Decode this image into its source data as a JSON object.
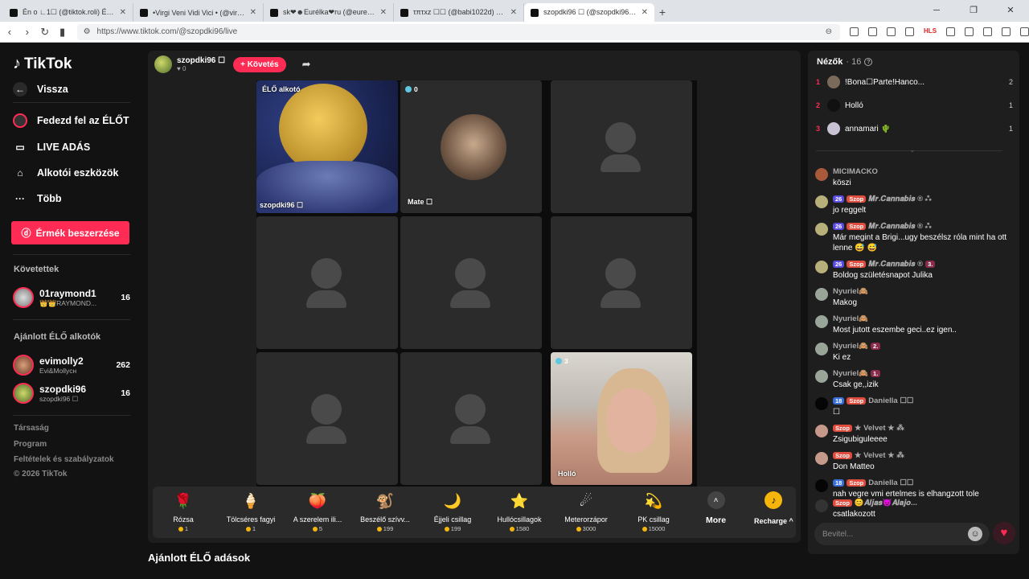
{
  "browser": {
    "tabs": [
      {
        "label": "Én o ∟1☐ (@tiktok.roli) ÉLŐ adá",
        "active": false
      },
      {
        "label": "•Virgi Veni Vidi Vici • (@virgivenivid",
        "active": false
      },
      {
        "label": "sk❤☻Eurélka❤ru (@eurekaeurel",
        "active": false
      },
      {
        "label": "τπτxz ☐☐ (@babi1022d) ÉLŐ adásba",
        "active": false
      },
      {
        "label": "szopdki96 ☐ (@szopdki96) ÉL",
        "active": true
      }
    ],
    "new_tab": "+",
    "url": "https://www.tiktok.com/@szopdki96/live"
  },
  "sidebar": {
    "logo": "TikTok",
    "back": "Vissza",
    "nav": [
      {
        "label": "Fedezd fel az ÉLŐT",
        "icon": "live-icon"
      },
      {
        "label": "LIVE ADÁS",
        "icon": "camera-icon"
      },
      {
        "label": "Alkotói eszközök",
        "icon": "house-icon"
      },
      {
        "label": "Több",
        "icon": "more-icon"
      }
    ],
    "coins_button": "Érmék beszerzése",
    "following_title": "Követettek",
    "following": [
      {
        "name": "01raymond1",
        "sub": "👑👑RAYMOND...",
        "count": "16"
      }
    ],
    "recommended_title": "Ajánlott ÉLŐ alkotók",
    "recommended": [
      {
        "name": "evimolly2",
        "sub": "Evi&Mollycн",
        "count": "262"
      },
      {
        "name": "szopdki96",
        "sub": "szopdki96 ☐",
        "count": "16"
      }
    ],
    "footer": [
      "Társaság",
      "Program",
      "Feltételek és szabályzatok",
      "© 2026 TikTok"
    ]
  },
  "live": {
    "host_name": "szopdki96 ☐",
    "host_likes": "♥ 0",
    "follow_label": "+ Követés",
    "cells": {
      "host_badge": "ÉLŐ alkotó",
      "host_label": "szopdki96 ☐",
      "mate_count": "0",
      "mate_label": "Mate ☐",
      "hollo_count": "3",
      "hollo_label": "Holló"
    },
    "gifts": [
      {
        "name": "Rózsa",
        "price": "1",
        "icon": "🌹"
      },
      {
        "name": "Tölcséres fagyi",
        "price": "1",
        "icon": "🍦"
      },
      {
        "name": "A szerelem ili...",
        "price": "5",
        "icon": "🍑"
      },
      {
        "name": "Beszélő szívv...",
        "price": "199",
        "icon": "🐒"
      },
      {
        "name": "Éjjeli csillag",
        "price": "199",
        "icon": "🌙"
      },
      {
        "name": "Hullócsillagok",
        "price": "1580",
        "icon": "⭐"
      },
      {
        "name": "Meterorzápor",
        "price": "3000",
        "icon": "☄"
      },
      {
        "name": "PK csillag",
        "price": "15000",
        "icon": "💫"
      }
    ],
    "more_label": "More",
    "recharge_label": "Recharge ^"
  },
  "recommended_heading": "Ajánlott ÉLŐ adások",
  "chat": {
    "viewers_title": "Nézők",
    "viewers_count": "· 16",
    "viewers": [
      {
        "rank": "1",
        "name": "!Bona☐Parte!Hanco...",
        "score": "2"
      },
      {
        "rank": "2",
        "name": "Holló",
        "score": "1"
      },
      {
        "rank": "3",
        "name": "annamari 🌵",
        "score": "1"
      }
    ],
    "messages": [
      {
        "user": "MICIMACKO",
        "level": "",
        "fan": "",
        "rank": "",
        "text": "köszi"
      },
      {
        "user": "𝑴𝒓.𝑪𝒂𝒏𝒏𝒂𝒃𝒊𝒔 ® ⁂",
        "level": "26",
        "fan": "Szop",
        "rank": "",
        "text": "jo reggelt"
      },
      {
        "user": "𝑴𝒓.𝑪𝒂𝒏𝒏𝒂𝒃𝒊𝒔 ® ⁂",
        "level": "26",
        "fan": "Szop",
        "rank": "",
        "text": "Már megint a Brigi...ugy beszélsz róla mint ha ott lenne 😅 😅"
      },
      {
        "user": "𝑴𝒓.𝑪𝒂𝒏𝒏𝒂𝒃𝒊𝒔 ®",
        "level": "26",
        "fan": "Szop",
        "rank": "3.",
        "text": "Boldog születésnapot Julika"
      },
      {
        "user": "Nyuriel🙈",
        "level": "",
        "fan": "",
        "rank": "",
        "text": "Makog"
      },
      {
        "user": "Nyuriel🙈",
        "level": "",
        "fan": "",
        "rank": "",
        "text": "Most jutott eszembe geci..ez igen.."
      },
      {
        "user": "Nyuriel🙈",
        "level": "",
        "fan": "",
        "rank": "2.",
        "text": "Ki ez"
      },
      {
        "user": "Nyuriel🙈",
        "level": "",
        "fan": "",
        "rank": "1.",
        "text": "Csak ge,,izik"
      },
      {
        "user": "Daniella ☐☐",
        "level": "18",
        "fan": "Szop",
        "rank": "",
        "text": "☐"
      },
      {
        "user": "★ Velvet ★ ⁂",
        "level": "",
        "fan": "Szop",
        "rank": "",
        "text": "Zsigubiguleeee"
      },
      {
        "user": "★ Velvet ★ ⁂",
        "level": "",
        "fan": "Szop",
        "rank": "",
        "text": "Don Matteo"
      },
      {
        "user": "Daniella ☐☐",
        "level": "18",
        "fan": "Szop",
        "rank": "",
        "text": "nah vegre vmi ertelmes is elhangzott tole"
      },
      {
        "user": "😊𝑨𝒍𝒋𝒂𝒔😈𝑨𝒍𝒂𝒋𝒐...",
        "level": "",
        "fan": "Szop",
        "rank": "",
        "text": "csatlakozott"
      }
    ],
    "input_placeholder": "Bevitel..."
  }
}
